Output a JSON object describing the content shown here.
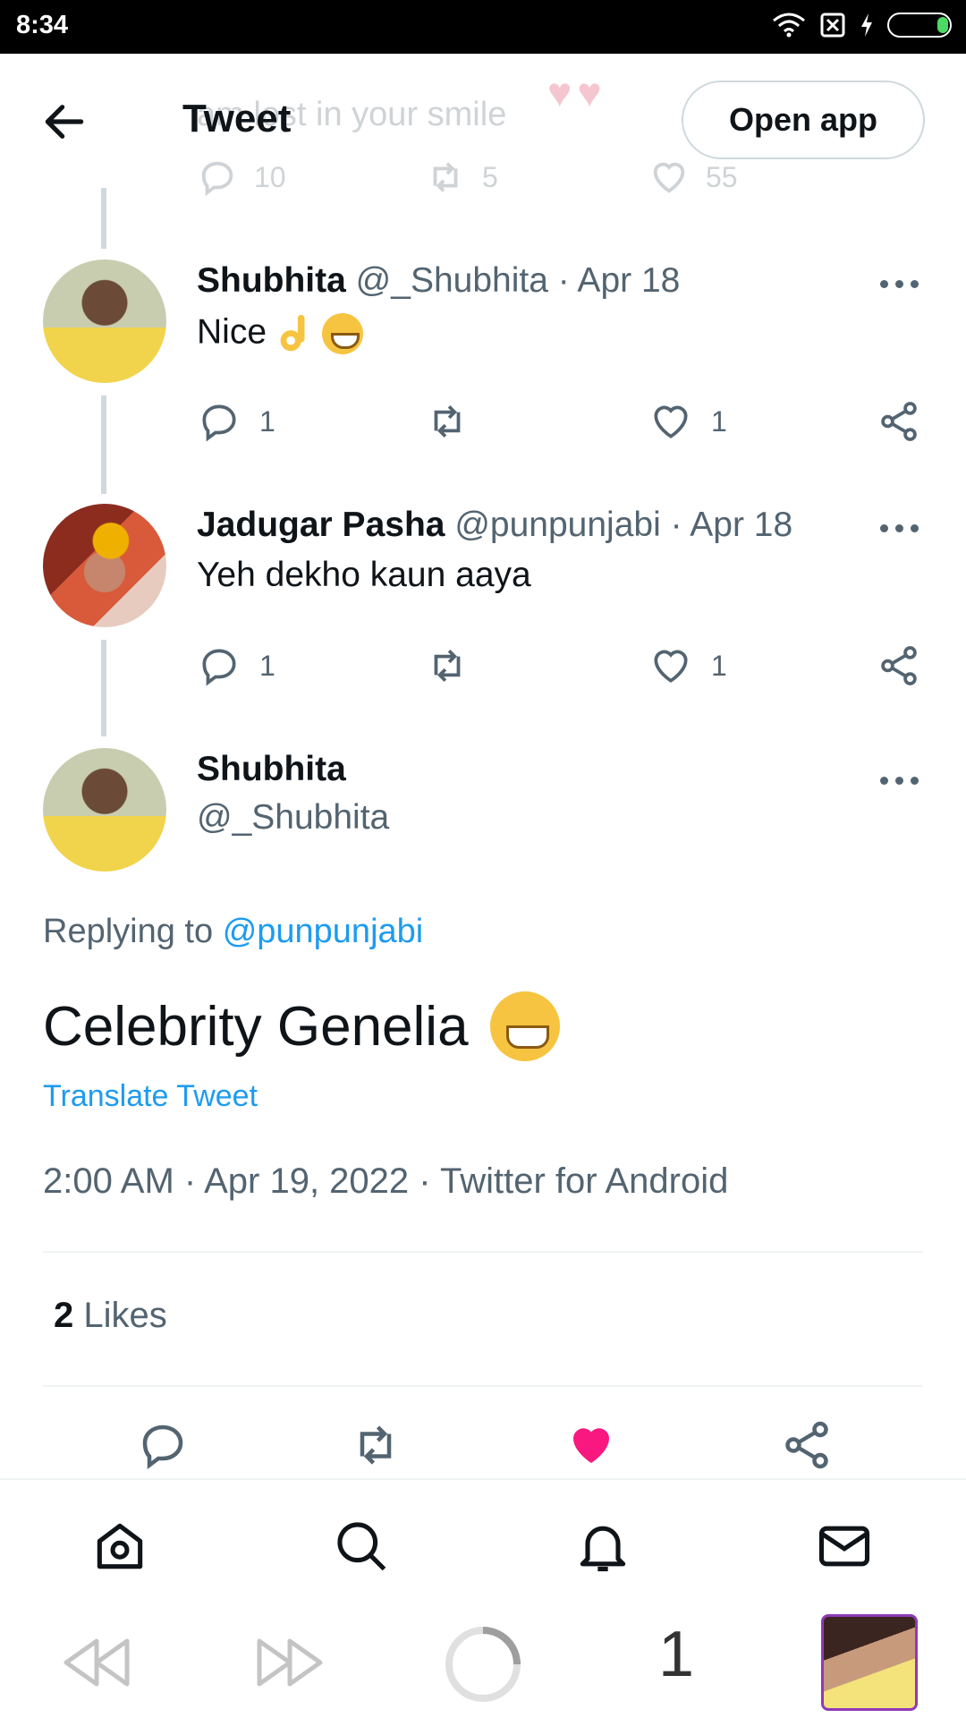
{
  "status_bar": {
    "time": "8:34"
  },
  "header": {
    "title": "Tweet",
    "open_app": "Open app"
  },
  "previous_tweet": {
    "text": "am lost in your smile",
    "reply_count": "10",
    "retweet_count": "5",
    "like_count": "55"
  },
  "replies": [
    {
      "name": "Shubhita",
      "handle": "@_Shubhita",
      "date": "· Apr 18",
      "text": "Nice",
      "reply_count": "1",
      "like_count": "1"
    },
    {
      "name": "Jadugar Pasha",
      "handle": "@punpunjabi",
      "date": "· Apr 18",
      "text": "Yeh dekho kaun aaya",
      "reply_count": "1",
      "like_count": "1"
    }
  ],
  "main_tweet": {
    "name": "Shubhita",
    "handle": "@_Shubhita",
    "replying_prefix": "Replying to",
    "replying_to": "@punpunjabi",
    "text": "Celebrity Genelia",
    "translate": "Translate Tweet",
    "meta": "2:00 AM · Apr 19, 2022 · Twitter for Android",
    "likes_count": "2",
    "likes_label": "Likes",
    "liked": true
  },
  "browser": {
    "tab_count": "1"
  },
  "colors": {
    "accent": "#1d9bf0",
    "like": "#f91880",
    "text": "#0f1419",
    "muted": "#536471"
  }
}
